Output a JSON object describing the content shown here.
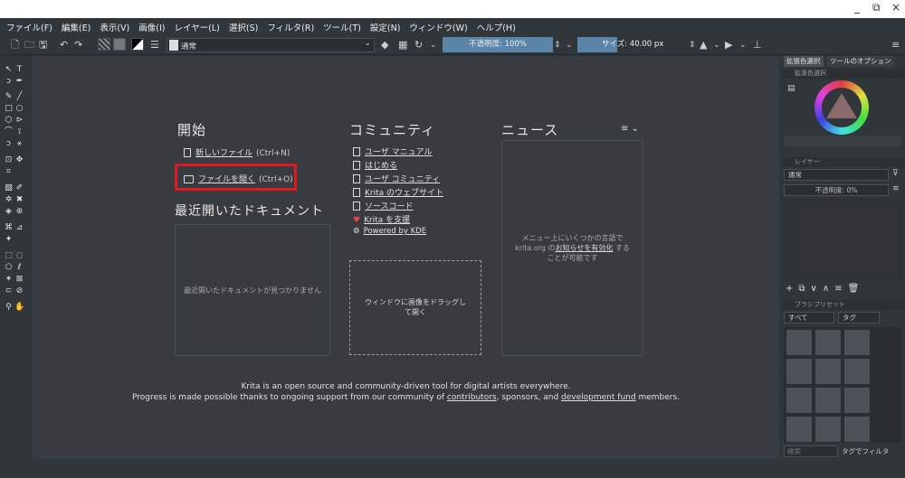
{
  "window_controls": {
    "minimize": "_",
    "restore": "⧉",
    "close": "×"
  },
  "menu": [
    "ファイル(F)",
    "編集(E)",
    "表示(V)",
    "画像(I)",
    "レイヤー(L)",
    "選択(S)",
    "フィルタ(R)",
    "ツール(T)",
    "設定(N)",
    "ウィンドウ(W)",
    "ヘルプ(H)"
  ],
  "toolbar": {
    "blend_mode": "通常",
    "opacity": "不透明度: 100%",
    "size": "サイズ: 40.00 px"
  },
  "welcome": {
    "start_title": "開始",
    "new_file": "新しいファイル",
    "new_file_shortcut": "(Ctrl+N)",
    "open_file": "ファイルを開く",
    "open_file_shortcut": "(Ctrl+O)",
    "recent_title": "最近開いたドキュメント",
    "recent_empty": "最近開いたドキュメントが見つかりません",
    "community_title": "コミュニティ",
    "community_links": [
      "ユーザ マニュアル",
      "はじめる",
      "ユーザ コミュニティ",
      "Krita のウェブサイト",
      "ソースコード",
      "Krita を支援",
      "Powered by KDE"
    ],
    "drop_text": "ウィンドウに画像をドラッグして開く",
    "news_title": "ニュース",
    "news_line1": "メニュー上にいくつかの言語で",
    "news_line2a": "krita.org の",
    "news_link": "お知らせを有効化",
    "news_line2b": " する",
    "news_line3": "ことが可能です",
    "footer_line1": "Krita is an open source and community-driven tool for digital artists everywhere.",
    "footer_line2a": "Progress is made possible thanks to ongoing support from our community of ",
    "footer_contributors": "contributors",
    "footer_line2b": ", sponsors, and ",
    "footer_devfund": "development fund",
    "footer_line2c": " members."
  },
  "dock": {
    "tab_color": "拡張色選択",
    "tab_tool": "ツールのオプション",
    "color_panel_title": "拡張色選択",
    "layers_title": "レイヤー",
    "layer_blend": "通常",
    "layer_opacity": "不透明度:  0%",
    "brush_title": "ブラシプリセット",
    "brush_filter": "すべて",
    "brush_tag": "タグ",
    "search_placeholder": "検索",
    "filter_tag": "タグでフィルタ"
  },
  "colors": {
    "accent": "#5a84a8",
    "highlight": "#e0191e",
    "bg": "#31363b"
  }
}
